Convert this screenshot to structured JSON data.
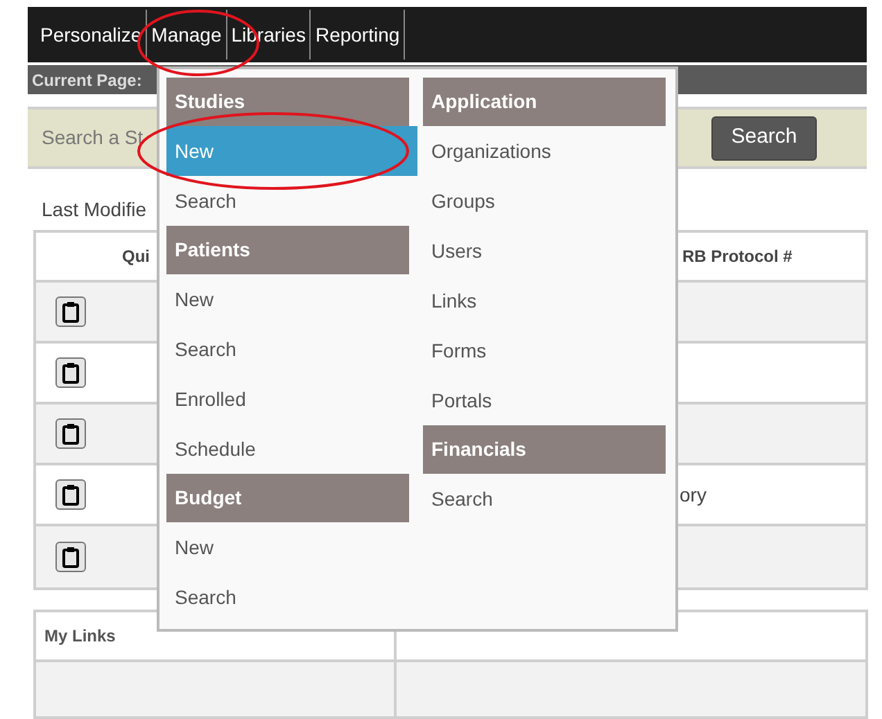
{
  "nav": {
    "items": [
      "Personalize",
      "Manage",
      "Libraries",
      "Reporting"
    ]
  },
  "current_page": {
    "label": "Current Page:"
  },
  "search": {
    "placeholder": "Search a St",
    "button": "Search"
  },
  "last_modified": {
    "label": "Last Modifie"
  },
  "table": {
    "columns": [
      "Qui",
      "RB Protocol #"
    ],
    "rows": [
      {
        "cell": ""
      },
      {
        "cell": ""
      },
      {
        "cell": ""
      },
      {
        "cell": "ory"
      },
      {
        "cell": ""
      }
    ]
  },
  "my_links": {
    "title": "My Links"
  },
  "menu": {
    "columns": [
      [
        {
          "title": "Studies",
          "items": [
            {
              "label": "New",
              "selected": true
            },
            {
              "label": "Search",
              "selected": false
            }
          ]
        },
        {
          "title": "Patients",
          "items": [
            {
              "label": "New",
              "selected": false
            },
            {
              "label": "Search",
              "selected": false
            },
            {
              "label": "Enrolled",
              "selected": false
            },
            {
              "label": "Schedule",
              "selected": false
            }
          ]
        },
        {
          "title": "Budget",
          "items": [
            {
              "label": "New",
              "selected": false
            },
            {
              "label": "Search",
              "selected": false
            }
          ]
        }
      ],
      [
        {
          "title": "Application",
          "items": [
            {
              "label": "Organizations",
              "selected": false
            },
            {
              "label": "Groups",
              "selected": false
            },
            {
              "label": "Users",
              "selected": false
            },
            {
              "label": "Links",
              "selected": false
            },
            {
              "label": "Forms",
              "selected": false
            },
            {
              "label": "Portals",
              "selected": false
            }
          ]
        },
        {
          "title": "Financials",
          "items": [
            {
              "label": "Search",
              "selected": false
            }
          ]
        }
      ]
    ]
  }
}
